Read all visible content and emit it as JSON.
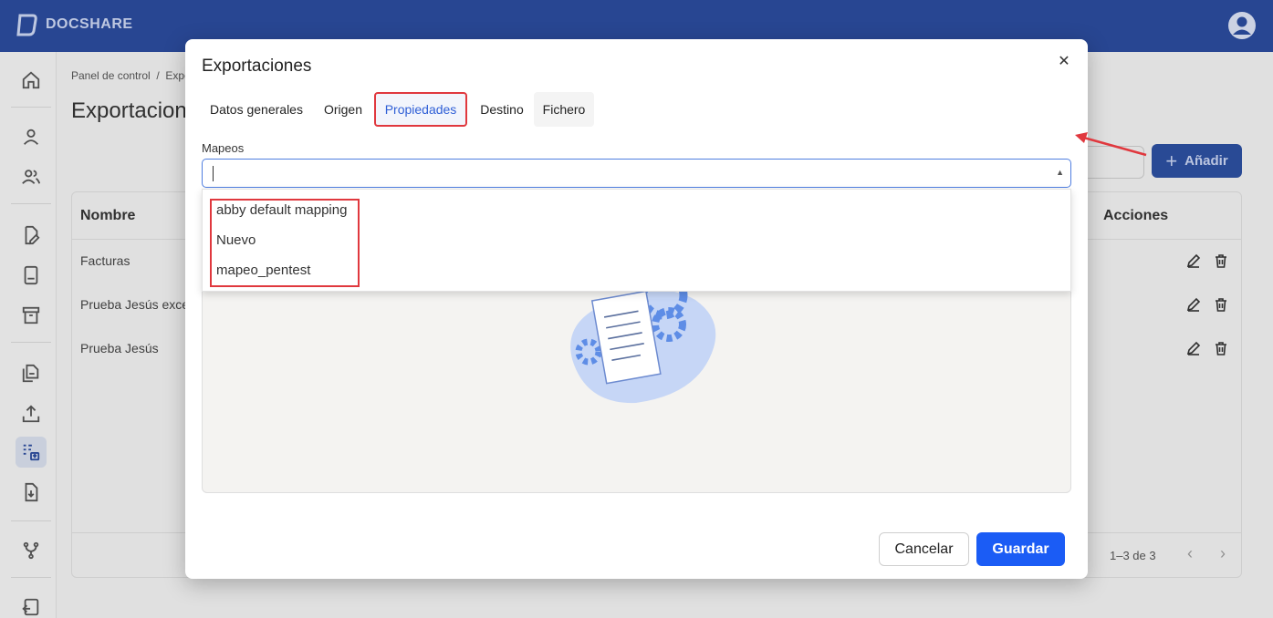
{
  "app": {
    "brand": "DOCSHARE"
  },
  "background_page": {
    "breadcrumb": {
      "root": "Panel de control",
      "separator": "/",
      "current": "Expo"
    },
    "title": "Exportacion",
    "add_button": {
      "icon": "plus-icon",
      "label": "Añadir"
    },
    "table": {
      "columns": [
        "Nombre",
        "Acciones"
      ],
      "rows": [
        "Facturas",
        "Prueba Jesús excel",
        "Prueba Jesús"
      ],
      "pagination": "1–3 de 3"
    }
  },
  "sidebar": {
    "icons": [
      "home-icon",
      "user-icon",
      "users-icon",
      "document-edit-icon",
      "book-icon",
      "archive-icon",
      "files-icon",
      "upload-icon",
      "export-list-icon",
      "import-icon",
      "flow-icon",
      "logout-icon"
    ],
    "active": "export-list-icon"
  },
  "modal": {
    "title": "Exportaciones",
    "tabs": [
      "Datos generales",
      "Origen",
      "Propiedades",
      "Destino",
      "Fichero"
    ],
    "selected_tab": "Propiedades",
    "field_label": "Mapeos",
    "input_value": "",
    "options": [
      "abby default mapping",
      "Nuevo",
      "mapeo_pentest"
    ],
    "cancel_label": "Cancelar",
    "save_label": "Guardar"
  },
  "colors": {
    "topbar": "#2b4a9a",
    "accent": "#1b5cf5",
    "highlight": "#e0383e"
  }
}
